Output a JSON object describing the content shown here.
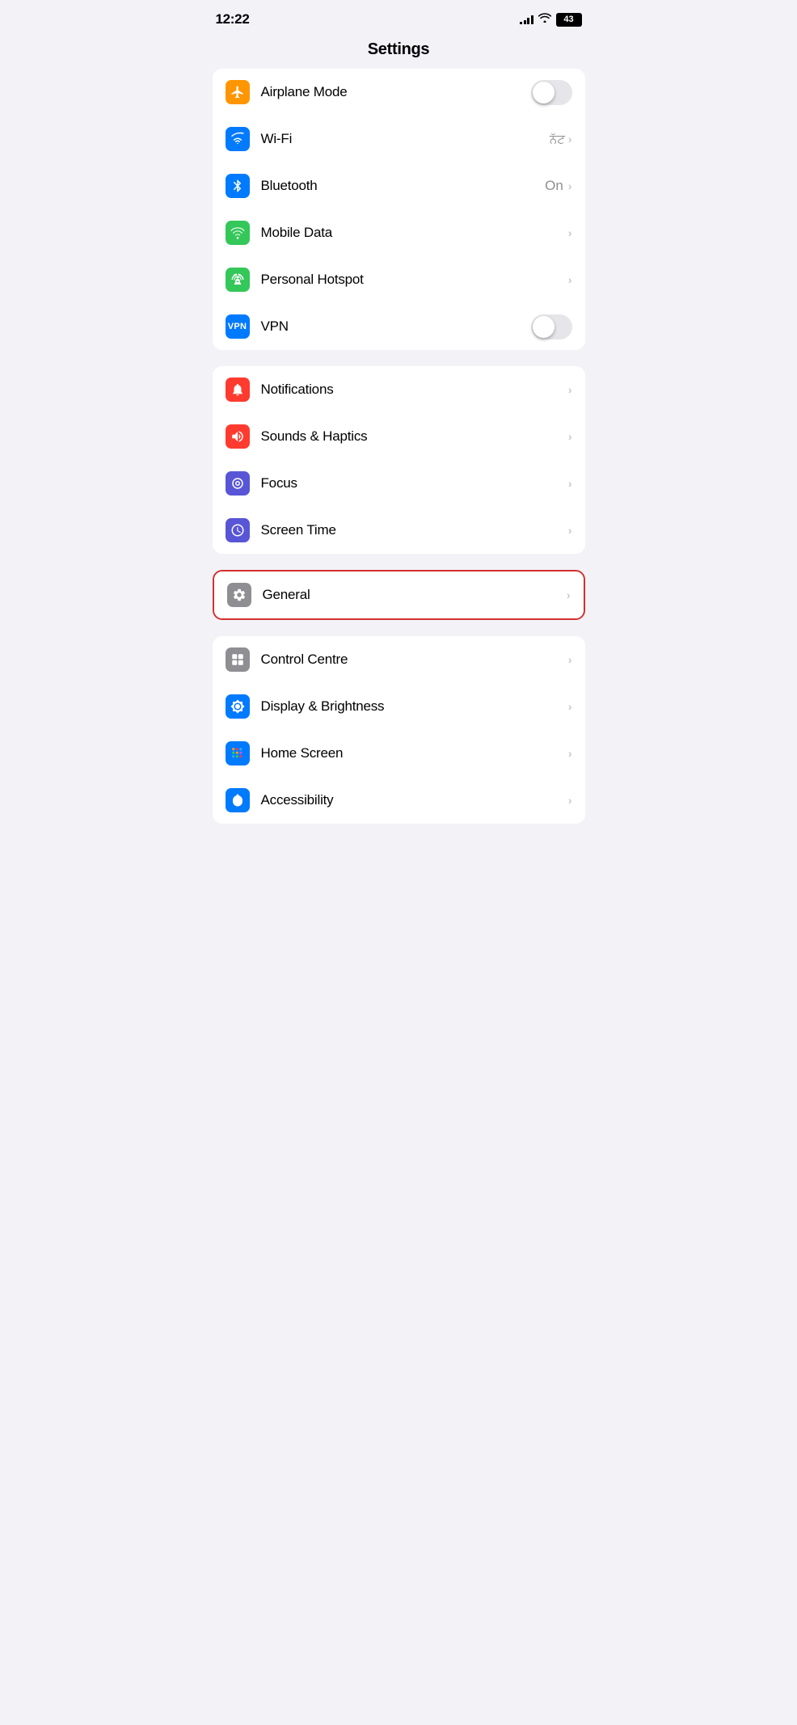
{
  "statusBar": {
    "time": "12:22",
    "battery": "43"
  },
  "pageTitle": "Settings",
  "groups": [
    {
      "id": "connectivity",
      "highlighted": false,
      "items": [
        {
          "id": "airplane-mode",
          "label": "Airplane Mode",
          "iconBg": "icon-orange",
          "iconType": "airplane",
          "control": "toggle",
          "toggleOn": false,
          "value": "",
          "hasChevron": false
        },
        {
          "id": "wifi",
          "label": "Wi-Fi",
          "iconBg": "icon-blue",
          "iconType": "wifi",
          "control": "chevron",
          "value": "ਨੱਟ",
          "hasChevron": true
        },
        {
          "id": "bluetooth",
          "label": "Bluetooth",
          "iconBg": "icon-bluetooth",
          "iconType": "bluetooth",
          "control": "chevron",
          "value": "On",
          "hasChevron": true
        },
        {
          "id": "mobile-data",
          "label": "Mobile Data",
          "iconBg": "icon-green-mobile",
          "iconType": "mobile-data",
          "control": "chevron",
          "value": "",
          "hasChevron": true
        },
        {
          "id": "personal-hotspot",
          "label": "Personal Hotspot",
          "iconBg": "icon-green-hotspot",
          "iconType": "hotspot",
          "control": "chevron",
          "value": "",
          "hasChevron": true
        },
        {
          "id": "vpn",
          "label": "VPN",
          "iconBg": "icon-vpn",
          "iconType": "vpn",
          "control": "toggle",
          "toggleOn": false,
          "value": "",
          "hasChevron": false
        }
      ]
    },
    {
      "id": "notifications",
      "highlighted": false,
      "items": [
        {
          "id": "notifications",
          "label": "Notifications",
          "iconBg": "icon-red-notif",
          "iconType": "notifications",
          "control": "chevron",
          "value": "",
          "hasChevron": true
        },
        {
          "id": "sounds-haptics",
          "label": "Sounds & Haptics",
          "iconBg": "icon-red-sound",
          "iconType": "sounds",
          "control": "chevron",
          "value": "",
          "hasChevron": true
        },
        {
          "id": "focus",
          "label": "Focus",
          "iconBg": "icon-purple-focus",
          "iconType": "focus",
          "control": "chevron",
          "value": "",
          "hasChevron": true
        },
        {
          "id": "screen-time",
          "label": "Screen Time",
          "iconBg": "icon-purple-screen",
          "iconType": "screen-time",
          "control": "chevron",
          "value": "",
          "hasChevron": true
        }
      ]
    },
    {
      "id": "general-group",
      "highlighted": true,
      "items": [
        {
          "id": "general",
          "label": "General",
          "iconBg": "icon-gray-general",
          "iconType": "general",
          "control": "chevron",
          "value": "",
          "hasChevron": true
        }
      ]
    },
    {
      "id": "display-group",
      "highlighted": false,
      "items": [
        {
          "id": "control-centre",
          "label": "Control Centre",
          "iconBg": "icon-gray-control",
          "iconType": "control-centre",
          "control": "chevron",
          "value": "",
          "hasChevron": true
        },
        {
          "id": "display-brightness",
          "label": "Display & Brightness",
          "iconBg": "icon-blue-display",
          "iconType": "display",
          "control": "chevron",
          "value": "",
          "hasChevron": true
        },
        {
          "id": "home-screen",
          "label": "Home Screen",
          "iconBg": "icon-multicolor-home",
          "iconType": "home-screen",
          "control": "chevron",
          "value": "",
          "hasChevron": true
        },
        {
          "id": "accessibility",
          "label": "Accessibility",
          "iconBg": "icon-blue-access",
          "iconType": "accessibility",
          "control": "chevron",
          "value": "",
          "hasChevron": true
        }
      ]
    }
  ]
}
